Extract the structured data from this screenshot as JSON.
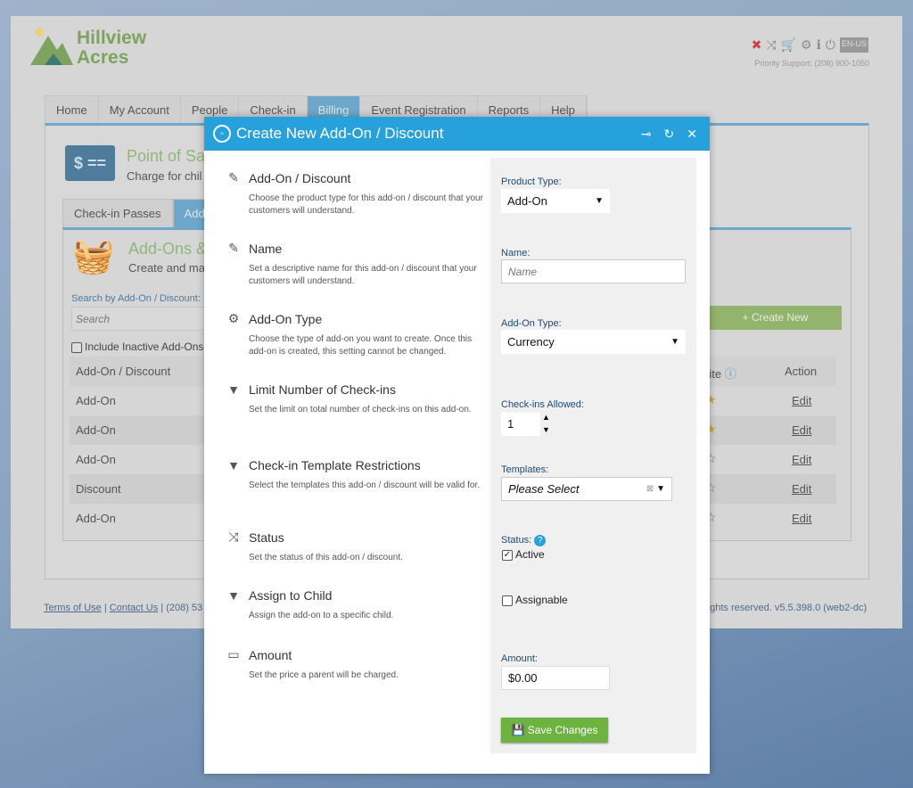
{
  "brand": {
    "line1": "Hillview",
    "line2": "Acres"
  },
  "header": {
    "support": "Priority Support: (208) 900-1050",
    "lang": "EN-US",
    "icons": [
      "tools-icon",
      "shuffle-icon",
      "cart-icon",
      "gear-icon",
      "info-icon",
      "power-icon"
    ]
  },
  "nav": [
    "Home",
    "My Account",
    "People",
    "Check-in",
    "Billing",
    "Event Registration",
    "Reports",
    "Help"
  ],
  "pos": {
    "title": "Point of Sa",
    "subtitle": "Charge for chil"
  },
  "subtabs": [
    "Check-in Passes",
    "Add-O"
  ],
  "addons": {
    "title": "Add-Ons &",
    "subtitle": "Create and ma",
    "search_label": "Search by Add-On / Discount:",
    "search_placeholder": "Search",
    "include_inactive": "Include Inactive Add-Ons",
    "create_new": "+ Create New",
    "columns": [
      "Add-On / Discount",
      "rite",
      "Action"
    ],
    "rows": [
      {
        "type": "Add-On",
        "fav": "★",
        "action": "Edit"
      },
      {
        "type": "Add-On",
        "fav": "★",
        "action": "Edit"
      },
      {
        "type": "Add-On",
        "fav": "☆",
        "action": "Edit"
      },
      {
        "type": "Discount",
        "fav": "☆",
        "action": "Edit"
      },
      {
        "type": "Add-On",
        "fav": "☆",
        "action": "Edit"
      }
    ]
  },
  "footer": {
    "terms": "Terms of Use",
    "contact": "Contact Us",
    "phone": "(208) 53",
    "rights": "rights reserved. v5.5.398.0 (web2-dc)"
  },
  "modal": {
    "title": "Create New Add-On / Discount",
    "sections": [
      {
        "title": "Add-On / Discount",
        "desc": "Choose the product type for this add-on / discount that your customers will understand.",
        "icon": "pencil-icon"
      },
      {
        "title": "Name",
        "desc": "Set a descriptive name for this add-on / discount that your customers will understand.",
        "icon": "pencil-icon"
      },
      {
        "title": "Add-On Type",
        "desc": "Choose the type of add-on you want to create. Once this add-on is created, this setting cannot be changed.",
        "icon": "gear-icon"
      },
      {
        "title": "Limit Number of Check-ins",
        "desc": "Set the limit on total number of check-ins on this add-on.",
        "icon": "filter-icon"
      },
      {
        "title": "Check-in Template Restrictions",
        "desc": "Select the templates this add-on / discount will be valid for.",
        "icon": "filter-icon"
      },
      {
        "title": "Status",
        "desc": "Set the status of this add-on / discount.",
        "icon": "shuffle-icon"
      },
      {
        "title": "Assign to Child",
        "desc": "Assign the add-on to a specific child.",
        "icon": "filter-icon"
      },
      {
        "title": "Amount",
        "desc": "Set the price a parent will be charged.",
        "icon": "money-icon"
      }
    ],
    "fields": {
      "product_type_label": "Product Type:",
      "product_type": "Add-On",
      "name_label": "Name:",
      "name_placeholder": "Name",
      "addon_type_label": "Add-On Type:",
      "addon_type": "Currency",
      "checkins_label": "Check-ins Allowed:",
      "checkins": "1",
      "templates_label": "Templates:",
      "templates_placeholder": "Please Select",
      "status_label": "Status:",
      "active_label": "Active",
      "active_checked": true,
      "assignable_label": "Assignable",
      "assignable_checked": false,
      "amount_label": "Amount:",
      "amount": "$0.00"
    },
    "save": "Save Changes"
  }
}
